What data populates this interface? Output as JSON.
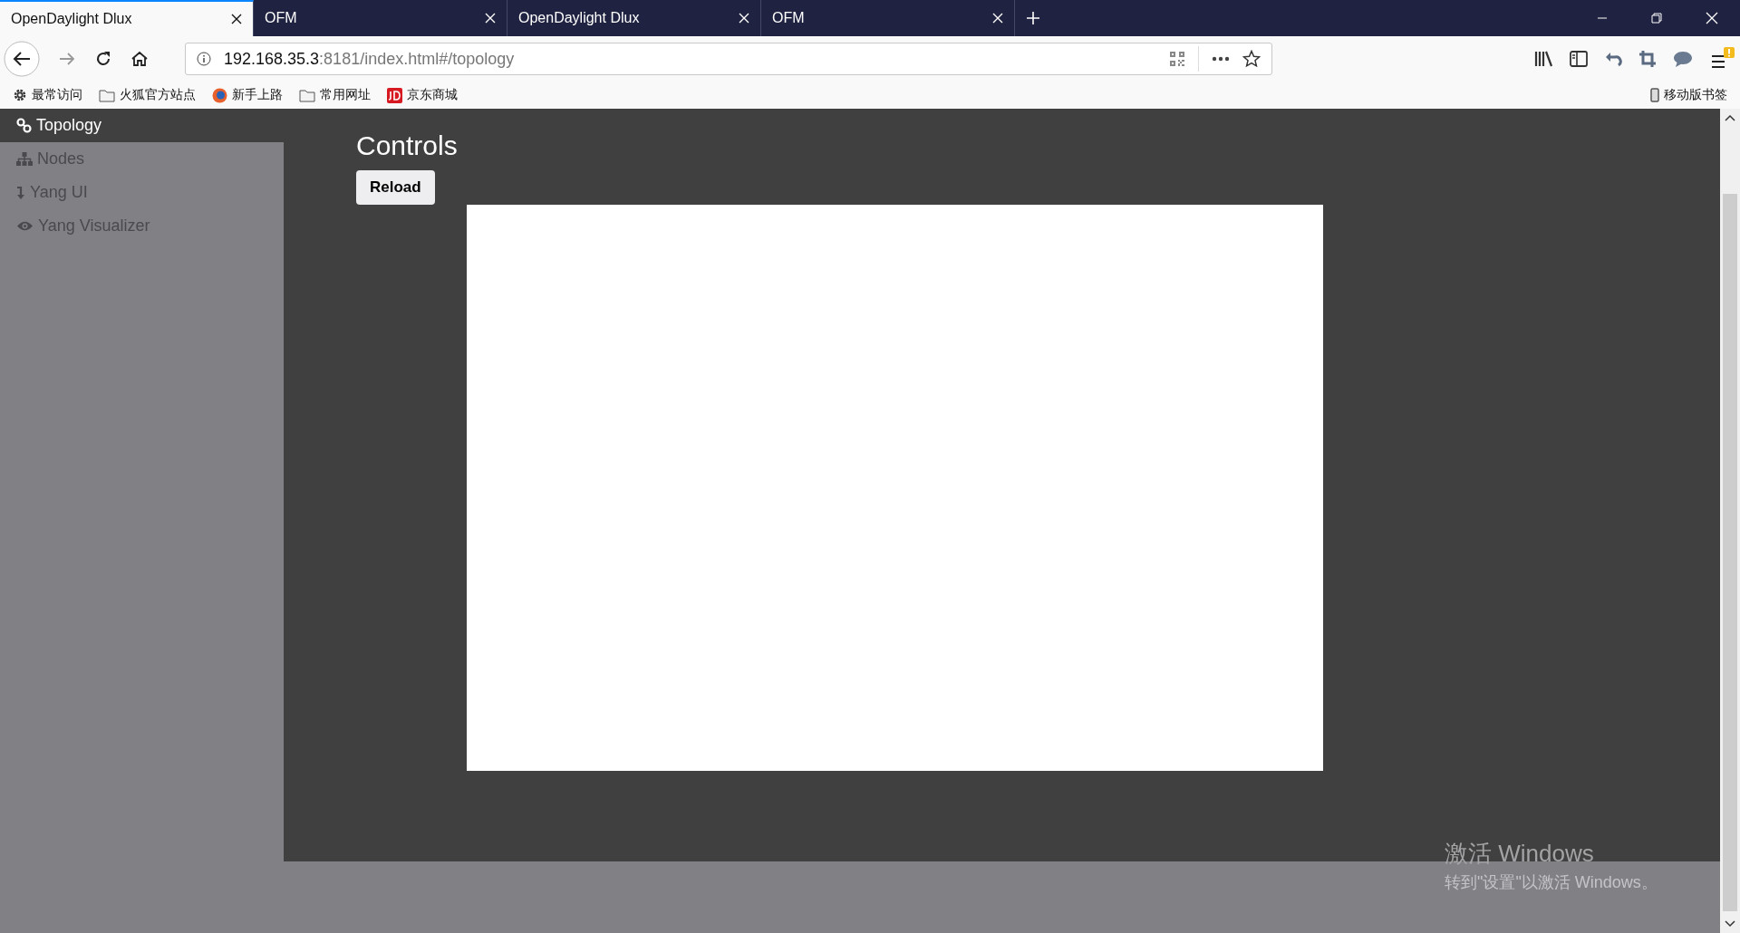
{
  "tabs": [
    {
      "title": "OpenDaylight Dlux",
      "selected": true
    },
    {
      "title": "OFM",
      "selected": false
    },
    {
      "title": "OpenDaylight Dlux",
      "selected": false
    },
    {
      "title": "OFM",
      "selected": false
    }
  ],
  "address": {
    "host": "192.168.35.3",
    "rest": ":8181/index.html#/topology"
  },
  "bookmarks": [
    {
      "label": "最常访问",
      "kind": "gear"
    },
    {
      "label": "火狐官方站点",
      "kind": "folder"
    },
    {
      "label": "新手上路",
      "kind": "firefox"
    },
    {
      "label": "常用网址",
      "kind": "folder"
    },
    {
      "label": "京东商城",
      "kind": "jd"
    }
  ],
  "mobile_bookmarks": "移动版书签",
  "sidebar": {
    "items": [
      {
        "label": "Topology",
        "kind": "link",
        "selected": true
      },
      {
        "label": "Nodes",
        "kind": "sitemap",
        "selected": false
      },
      {
        "label": "Yang UI",
        "kind": "arrow",
        "selected": false
      },
      {
        "label": "Yang Visualizer",
        "kind": "eye",
        "selected": false
      }
    ]
  },
  "heading": "Controls",
  "reload_button": "Reload",
  "activation": {
    "title": "激活 Windows",
    "text": "转到\"设置\"以激活 Windows。"
  }
}
